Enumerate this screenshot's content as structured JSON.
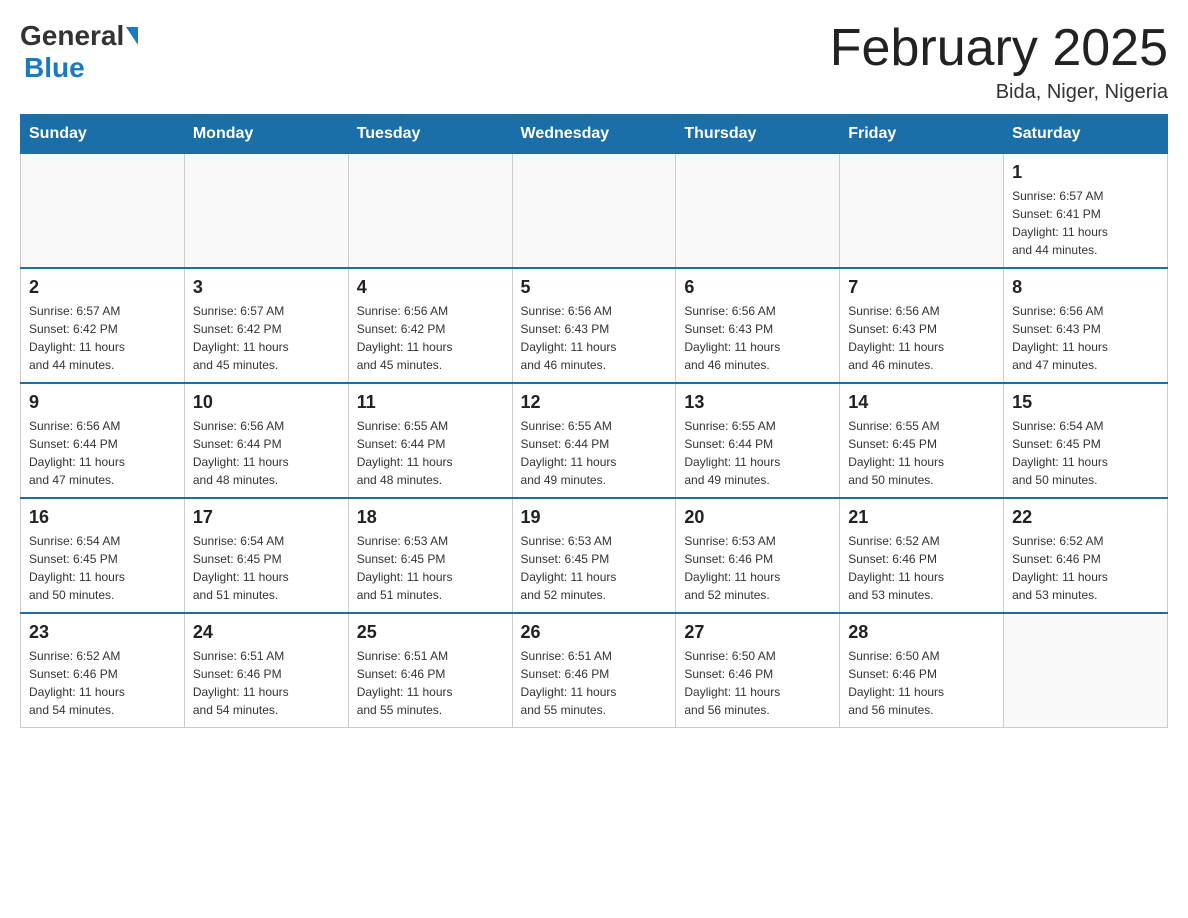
{
  "header": {
    "logo_general": "General",
    "logo_blue": "Blue",
    "month_title": "February 2025",
    "location": "Bida, Niger, Nigeria"
  },
  "days_of_week": [
    "Sunday",
    "Monday",
    "Tuesday",
    "Wednesday",
    "Thursday",
    "Friday",
    "Saturday"
  ],
  "weeks": [
    {
      "days": [
        {
          "number": "",
          "info": ""
        },
        {
          "number": "",
          "info": ""
        },
        {
          "number": "",
          "info": ""
        },
        {
          "number": "",
          "info": ""
        },
        {
          "number": "",
          "info": ""
        },
        {
          "number": "",
          "info": ""
        },
        {
          "number": "1",
          "info": "Sunrise: 6:57 AM\nSunset: 6:41 PM\nDaylight: 11 hours\nand 44 minutes."
        }
      ]
    },
    {
      "days": [
        {
          "number": "2",
          "info": "Sunrise: 6:57 AM\nSunset: 6:42 PM\nDaylight: 11 hours\nand 44 minutes."
        },
        {
          "number": "3",
          "info": "Sunrise: 6:57 AM\nSunset: 6:42 PM\nDaylight: 11 hours\nand 45 minutes."
        },
        {
          "number": "4",
          "info": "Sunrise: 6:56 AM\nSunset: 6:42 PM\nDaylight: 11 hours\nand 45 minutes."
        },
        {
          "number": "5",
          "info": "Sunrise: 6:56 AM\nSunset: 6:43 PM\nDaylight: 11 hours\nand 46 minutes."
        },
        {
          "number": "6",
          "info": "Sunrise: 6:56 AM\nSunset: 6:43 PM\nDaylight: 11 hours\nand 46 minutes."
        },
        {
          "number": "7",
          "info": "Sunrise: 6:56 AM\nSunset: 6:43 PM\nDaylight: 11 hours\nand 46 minutes."
        },
        {
          "number": "8",
          "info": "Sunrise: 6:56 AM\nSunset: 6:43 PM\nDaylight: 11 hours\nand 47 minutes."
        }
      ]
    },
    {
      "days": [
        {
          "number": "9",
          "info": "Sunrise: 6:56 AM\nSunset: 6:44 PM\nDaylight: 11 hours\nand 47 minutes."
        },
        {
          "number": "10",
          "info": "Sunrise: 6:56 AM\nSunset: 6:44 PM\nDaylight: 11 hours\nand 48 minutes."
        },
        {
          "number": "11",
          "info": "Sunrise: 6:55 AM\nSunset: 6:44 PM\nDaylight: 11 hours\nand 48 minutes."
        },
        {
          "number": "12",
          "info": "Sunrise: 6:55 AM\nSunset: 6:44 PM\nDaylight: 11 hours\nand 49 minutes."
        },
        {
          "number": "13",
          "info": "Sunrise: 6:55 AM\nSunset: 6:44 PM\nDaylight: 11 hours\nand 49 minutes."
        },
        {
          "number": "14",
          "info": "Sunrise: 6:55 AM\nSunset: 6:45 PM\nDaylight: 11 hours\nand 50 minutes."
        },
        {
          "number": "15",
          "info": "Sunrise: 6:54 AM\nSunset: 6:45 PM\nDaylight: 11 hours\nand 50 minutes."
        }
      ]
    },
    {
      "days": [
        {
          "number": "16",
          "info": "Sunrise: 6:54 AM\nSunset: 6:45 PM\nDaylight: 11 hours\nand 50 minutes."
        },
        {
          "number": "17",
          "info": "Sunrise: 6:54 AM\nSunset: 6:45 PM\nDaylight: 11 hours\nand 51 minutes."
        },
        {
          "number": "18",
          "info": "Sunrise: 6:53 AM\nSunset: 6:45 PM\nDaylight: 11 hours\nand 51 minutes."
        },
        {
          "number": "19",
          "info": "Sunrise: 6:53 AM\nSunset: 6:45 PM\nDaylight: 11 hours\nand 52 minutes."
        },
        {
          "number": "20",
          "info": "Sunrise: 6:53 AM\nSunset: 6:46 PM\nDaylight: 11 hours\nand 52 minutes."
        },
        {
          "number": "21",
          "info": "Sunrise: 6:52 AM\nSunset: 6:46 PM\nDaylight: 11 hours\nand 53 minutes."
        },
        {
          "number": "22",
          "info": "Sunrise: 6:52 AM\nSunset: 6:46 PM\nDaylight: 11 hours\nand 53 minutes."
        }
      ]
    },
    {
      "days": [
        {
          "number": "23",
          "info": "Sunrise: 6:52 AM\nSunset: 6:46 PM\nDaylight: 11 hours\nand 54 minutes."
        },
        {
          "number": "24",
          "info": "Sunrise: 6:51 AM\nSunset: 6:46 PM\nDaylight: 11 hours\nand 54 minutes."
        },
        {
          "number": "25",
          "info": "Sunrise: 6:51 AM\nSunset: 6:46 PM\nDaylight: 11 hours\nand 55 minutes."
        },
        {
          "number": "26",
          "info": "Sunrise: 6:51 AM\nSunset: 6:46 PM\nDaylight: 11 hours\nand 55 minutes."
        },
        {
          "number": "27",
          "info": "Sunrise: 6:50 AM\nSunset: 6:46 PM\nDaylight: 11 hours\nand 56 minutes."
        },
        {
          "number": "28",
          "info": "Sunrise: 6:50 AM\nSunset: 6:46 PM\nDaylight: 11 hours\nand 56 minutes."
        },
        {
          "number": "",
          "info": ""
        }
      ]
    }
  ]
}
